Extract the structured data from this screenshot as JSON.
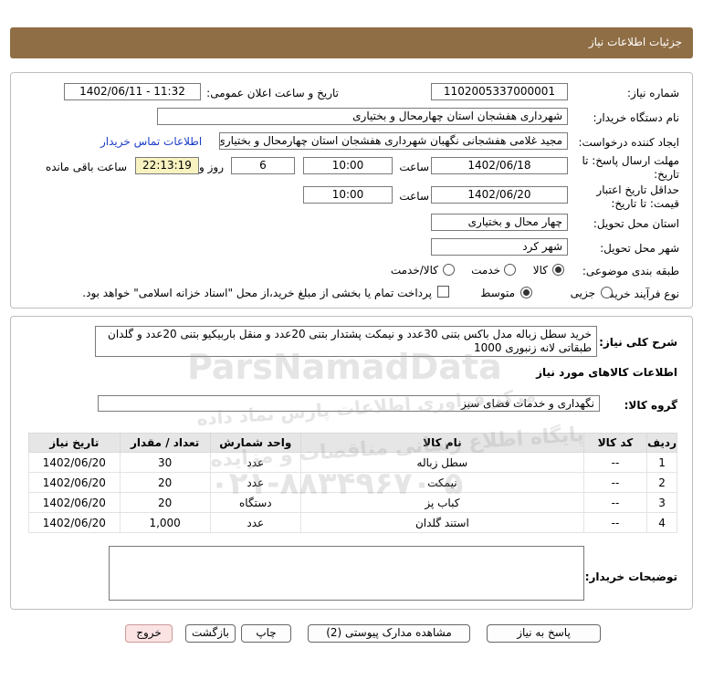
{
  "header": {
    "title": "جزئیات اطلاعات نیاز"
  },
  "form": {
    "need_number_label": "شماره نیاز:",
    "need_number": "1102005337000001",
    "announce_label": "تاریخ و ساعت اعلان عمومی:",
    "announce_value": "1402/06/11 - 11:32",
    "buyer_org_label": "نام دستگاه خریدار:",
    "buyer_org": "شهرداری هفشجان استان چهارمحال و بختیاری",
    "creator_label": "ایجاد کننده درخواست:",
    "creator": "مجید غلامی هفشجانی نگهبان شهرداری هفشجان استان چهارمحال و بختیاری",
    "contact_link": "اطلاعات تماس خریدار",
    "deadline_label_1": "مهلت ارسال پاسخ: تا",
    "deadline_label_2": "تاریخ:",
    "deadline_date": "1402/06/18",
    "time_label": "ساعت",
    "deadline_time": "10:00",
    "days_value": "6",
    "days_label": "روز و",
    "remaining_time": "22:13:19",
    "remaining_label": "ساعت باقی مانده",
    "validity_label_1": "حداقل تاریخ اعتبار",
    "validity_label_2": "قیمت: تا تاریخ:",
    "validity_date": "1402/06/20",
    "validity_time_label": "ساعت",
    "validity_time": "10:00",
    "province_label": "استان محل تحویل:",
    "province": "چهار محال و بختیاری",
    "city_label": "شهر محل تحویل:",
    "city": "شهر کرد",
    "category_label": "طبقه بندی موضوعی:",
    "category_options": [
      "کالا",
      "خدمت",
      "کالا/خدمت"
    ],
    "process_label": "نوع فرآیند خرید :",
    "process_options": [
      "جزیی",
      "متوسط"
    ],
    "payment_note": "پرداخت تمام یا بخشی از مبلغ خرید،از محل \"اسناد خزانه اسلامی\" خواهد بود."
  },
  "details": {
    "summary_label": "شرح کلی نیاز:",
    "summary_line1": "خرید سطل زباله مدل باکس بتنی 30عدد و نیمکت پشتدار بتنی 20عدد و منقل باربیکیو بتنی 20عدد و گلدان",
    "summary_line2": "طبقاتی لانه زنبوری 1000",
    "goods_info_title": "اطلاعات کالاهای مورد نیاز",
    "goods_group_label": "گروه کالا:",
    "goods_group": "نگهداری و خدمات فضای سبز",
    "buyer_notes_label": "توضیحات خریدار:"
  },
  "table": {
    "headers": [
      "ردیف",
      "کد کالا",
      "نام کالا",
      "واحد شمارش",
      "تعداد / مقدار",
      "تاریخ نیاز"
    ],
    "rows": [
      [
        "1",
        "--",
        "سطل زباله",
        "عدد",
        "30",
        "1402/06/20"
      ],
      [
        "2",
        "--",
        "نیمکت",
        "عدد",
        "20",
        "1402/06/20"
      ],
      [
        "3",
        "--",
        "کباب پز",
        "دستگاه",
        "20",
        "1402/06/20"
      ],
      [
        "4",
        "--",
        "استند گلدان",
        "عدد",
        "1,000",
        "1402/06/20"
      ]
    ]
  },
  "buttons": {
    "reply": "پاسخ به نیاز",
    "view_docs": "مشاهده مدارک پیوستی (2)",
    "print": "چاپ",
    "back": "بازگشت",
    "exit": "خروج"
  },
  "watermark": {
    "brand": "ParsNamadData",
    "line1": "مرکز فراوری اطلاعات پارس نماد داده",
    "line2": "پایگاه اطلاع رسانی مناقصات و مزایده",
    "phone": "۰۲۱-۸۸۳۴۹۶۷۰-۵"
  },
  "colors": {
    "header": "#8f6e45",
    "remaining_bg": "#f7f2c0",
    "link": "#1a3cc7",
    "exit_bg": "#fbe3e3"
  }
}
